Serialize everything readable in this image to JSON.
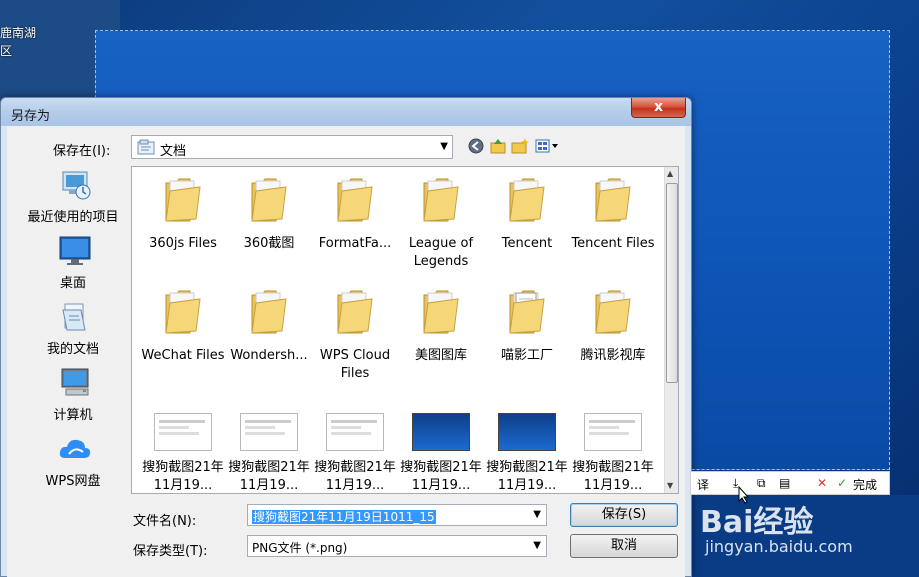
{
  "desktop": {
    "label_line1": "鹿南湖",
    "label_line2": "区"
  },
  "dialog": {
    "title": "另存为",
    "close_glyph": "x",
    "save_in_label": "保存在(I):",
    "save_in_value": "文档",
    "places": [
      {
        "label": "最近使用的项目",
        "icon": "recent-items-icon"
      },
      {
        "label": "桌面",
        "icon": "desktop-icon"
      },
      {
        "label": "我的文档",
        "icon": "my-documents-icon"
      },
      {
        "label": "计算机",
        "icon": "computer-icon"
      },
      {
        "label": "WPS网盘",
        "icon": "wps-cloud-icon"
      }
    ],
    "files": [
      {
        "name": "360js Files",
        "type": "folder"
      },
      {
        "name": "360截图",
        "type": "folder"
      },
      {
        "name": "FormatFa...",
        "type": "folder"
      },
      {
        "name": "League of Legends",
        "type": "folder"
      },
      {
        "name": "Tencent",
        "type": "folder"
      },
      {
        "name": "Tencent Files",
        "type": "folder"
      },
      {
        "name": "WeChat Files",
        "type": "folder"
      },
      {
        "name": "Wondersh...",
        "type": "folder-app"
      },
      {
        "name": "WPS Cloud Files",
        "type": "folder"
      },
      {
        "name": "美图图库",
        "type": "folder"
      },
      {
        "name": "喵影工厂",
        "type": "folder-docs"
      },
      {
        "name": "腾讯影视库",
        "type": "folder"
      },
      {
        "name": "搜狗截图21年11月19...",
        "type": "image"
      },
      {
        "name": "搜狗截图21年11月19...",
        "type": "image"
      },
      {
        "name": "搜狗截图21年11月19...",
        "type": "image"
      },
      {
        "name": "搜狗截图21年11月19...",
        "type": "image-blue"
      },
      {
        "name": "搜狗截图21年11月19...",
        "type": "image-blue"
      },
      {
        "name": "搜狗截图21年11月19...",
        "type": "image"
      }
    ],
    "filename_label": "文件名(N):",
    "filename_value": "搜狗截图21年11月19日1011_15",
    "filetype_label": "保存类型(T):",
    "filetype_value": "PNG文件 (*.png)",
    "save_button": "保存(S)",
    "cancel_button": "取消"
  },
  "screenshot_toolbar": {
    "translate": "译",
    "done": "完成"
  },
  "watermark": {
    "brand": "Bai经验",
    "url": "jingyan.baidu.com"
  }
}
